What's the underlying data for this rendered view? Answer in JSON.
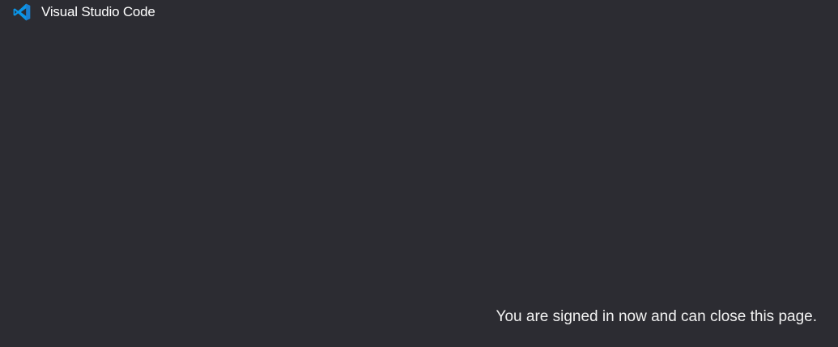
{
  "header": {
    "logo_icon": "vscode-logo-icon",
    "title": "Visual Studio Code",
    "accent_color": "#0a95e8"
  },
  "main": {
    "message": "You are signed in now and can close this page."
  },
  "theme": {
    "background": "#2c2c32",
    "text": "#ffffff"
  }
}
